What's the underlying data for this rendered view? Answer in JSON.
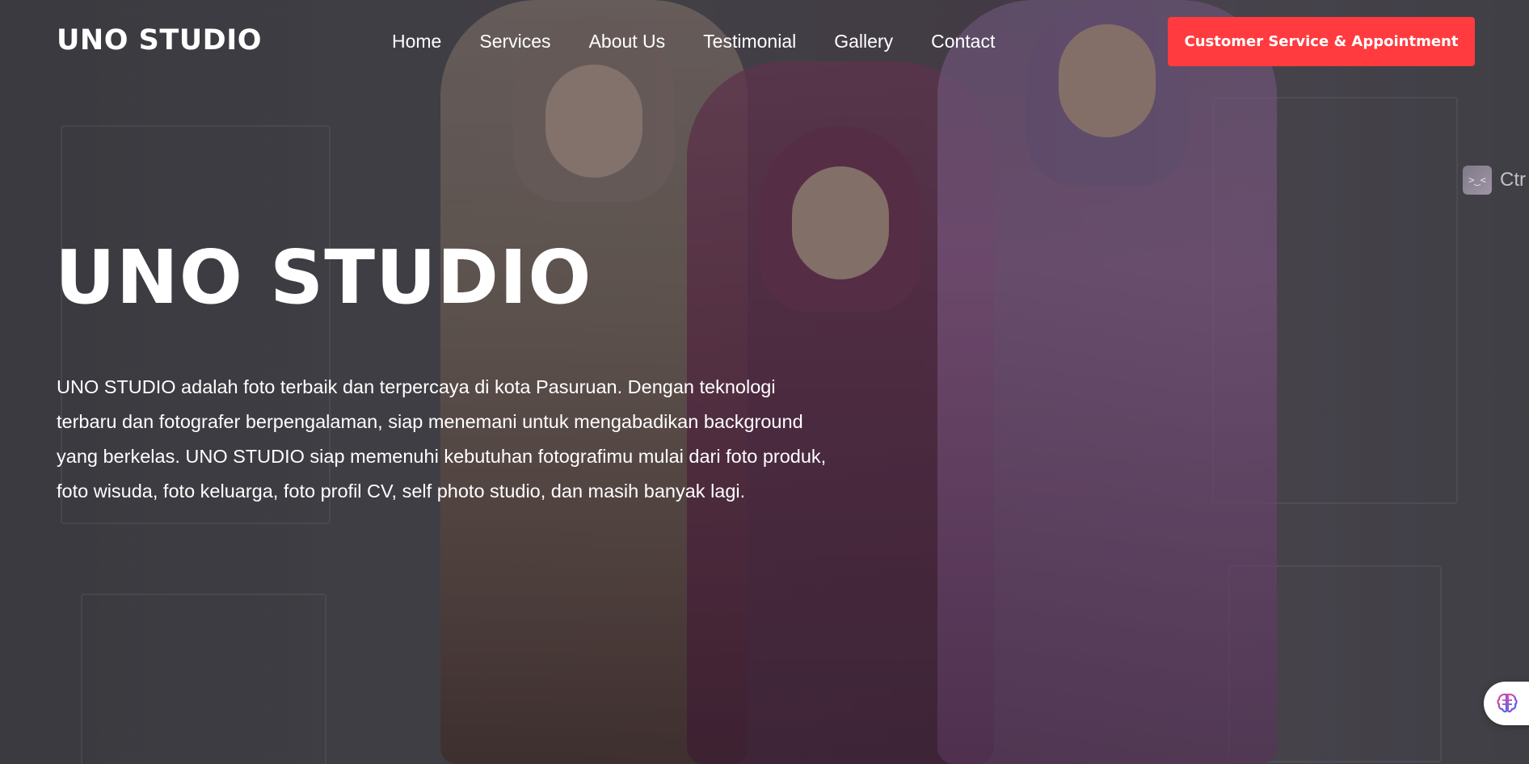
{
  "nav": {
    "logo": "UNO STUDIO",
    "items": [
      {
        "label": "Home"
      },
      {
        "label": "Services"
      },
      {
        "label": "About Us"
      },
      {
        "label": "Testimonial"
      },
      {
        "label": "Gallery"
      },
      {
        "label": "Contact"
      }
    ],
    "cta_label": "Customer Service & Appointment",
    "cta_color": "#ff3b3f"
  },
  "hero": {
    "title": "UNO STUDIO",
    "description": "UNO STUDIO adalah foto terbaik dan terpercaya di kota Pasuruan. Dengan teknologi terbaru dan fotografer berpengalaman, siap menemani untuk mengabadikan background yang berkelas. UNO STUDIO siap memenuhi kebutuhan fotografimu mulai dari foto produk, foto wisuda, foto keluarga, foto profil CV, self photo studio, dan masih banyak lagi."
  },
  "side_widget": {
    "icon": "terminal-face-icon",
    "glyph": ">‿<",
    "text": "Ctr"
  },
  "floating_button": {
    "icon": "brain-icon"
  }
}
